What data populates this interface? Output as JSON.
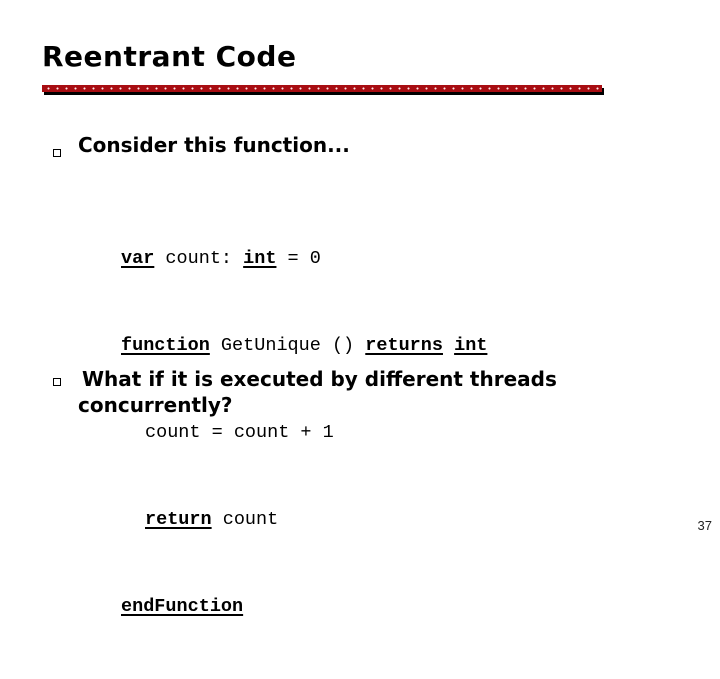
{
  "slide": {
    "title": "Reentrant Code",
    "accent_color": "#a80d12",
    "bullets": [
      {
        "icon": "square-bullet-icon",
        "text": "Consider this function..."
      },
      {
        "icon": "square-bullet-icon",
        "text_line1": "What if it is executed by different threads",
        "text_line2": "concurrently?"
      }
    ],
    "code": {
      "line1": {
        "kw1": "var",
        "t1": " count: ",
        "kw2": "int",
        "t2": " = 0"
      },
      "line2": {
        "kw1": "function",
        "t1": " GetUnique () ",
        "kw2": "returns",
        "t2": " ",
        "kw3": "int"
      },
      "line3": {
        "t1": "count = count + 1"
      },
      "line4": {
        "kw1": "return",
        "t1": " count"
      },
      "line5": {
        "kw1": "endFunction"
      }
    },
    "page_number": "37"
  }
}
